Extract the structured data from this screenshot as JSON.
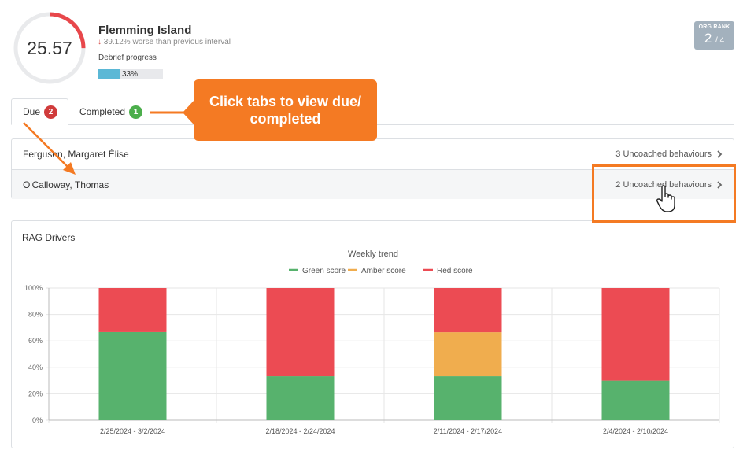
{
  "score": {
    "value": "25.57",
    "ring_color": "#e8474b",
    "track_color": "#e9eaec",
    "fill_fraction": 0.25
  },
  "location": {
    "name": "Flemming Island",
    "trend_text": "39.12% worse than previous interval",
    "debrief_label": "Debrief progress",
    "progress_percent": 33,
    "progress_text": "33%"
  },
  "org_rank": {
    "label": "ORG RANK",
    "rank": "2",
    "total": "/ 4"
  },
  "tabs": [
    {
      "label": "Due",
      "count": "2",
      "active": true
    },
    {
      "label": "Completed",
      "count": "1",
      "active": false
    }
  ],
  "callout": {
    "text": "Click tabs to view due/ completed",
    "color": "#f47a23"
  },
  "list": [
    {
      "name": "Ferguson, Margaret Élise",
      "status": "3 Uncoached behaviours"
    },
    {
      "name": "O'Calloway, Thomas",
      "status": "2 Uncoached behaviours"
    }
  ],
  "rag_title": "RAG Drivers",
  "chart_data": {
    "type": "bar",
    "stacked": true,
    "title": "Weekly trend",
    "categories": [
      "2/25/2024 - 3/2/2024",
      "2/18/2024 - 2/24/2024",
      "2/11/2024 - 2/17/2024",
      "2/4/2024 - 2/10/2024"
    ],
    "series": [
      {
        "name": "Green score",
        "color": "#57b26d",
        "values": [
          66.7,
          33.3,
          33.3,
          30
        ]
      },
      {
        "name": "Amber score",
        "color": "#f0ad4e",
        "values": [
          0,
          0,
          33.3,
          0
        ]
      },
      {
        "name": "Red score",
        "color": "#ec4b53",
        "values": [
          33.3,
          66.7,
          33.4,
          70
        ]
      }
    ],
    "y_ticks": [
      "0%",
      "20%",
      "40%",
      "60%",
      "80%",
      "100%"
    ],
    "ylim": [
      0,
      100
    ],
    "legend_position": "top-center",
    "grid": true
  }
}
